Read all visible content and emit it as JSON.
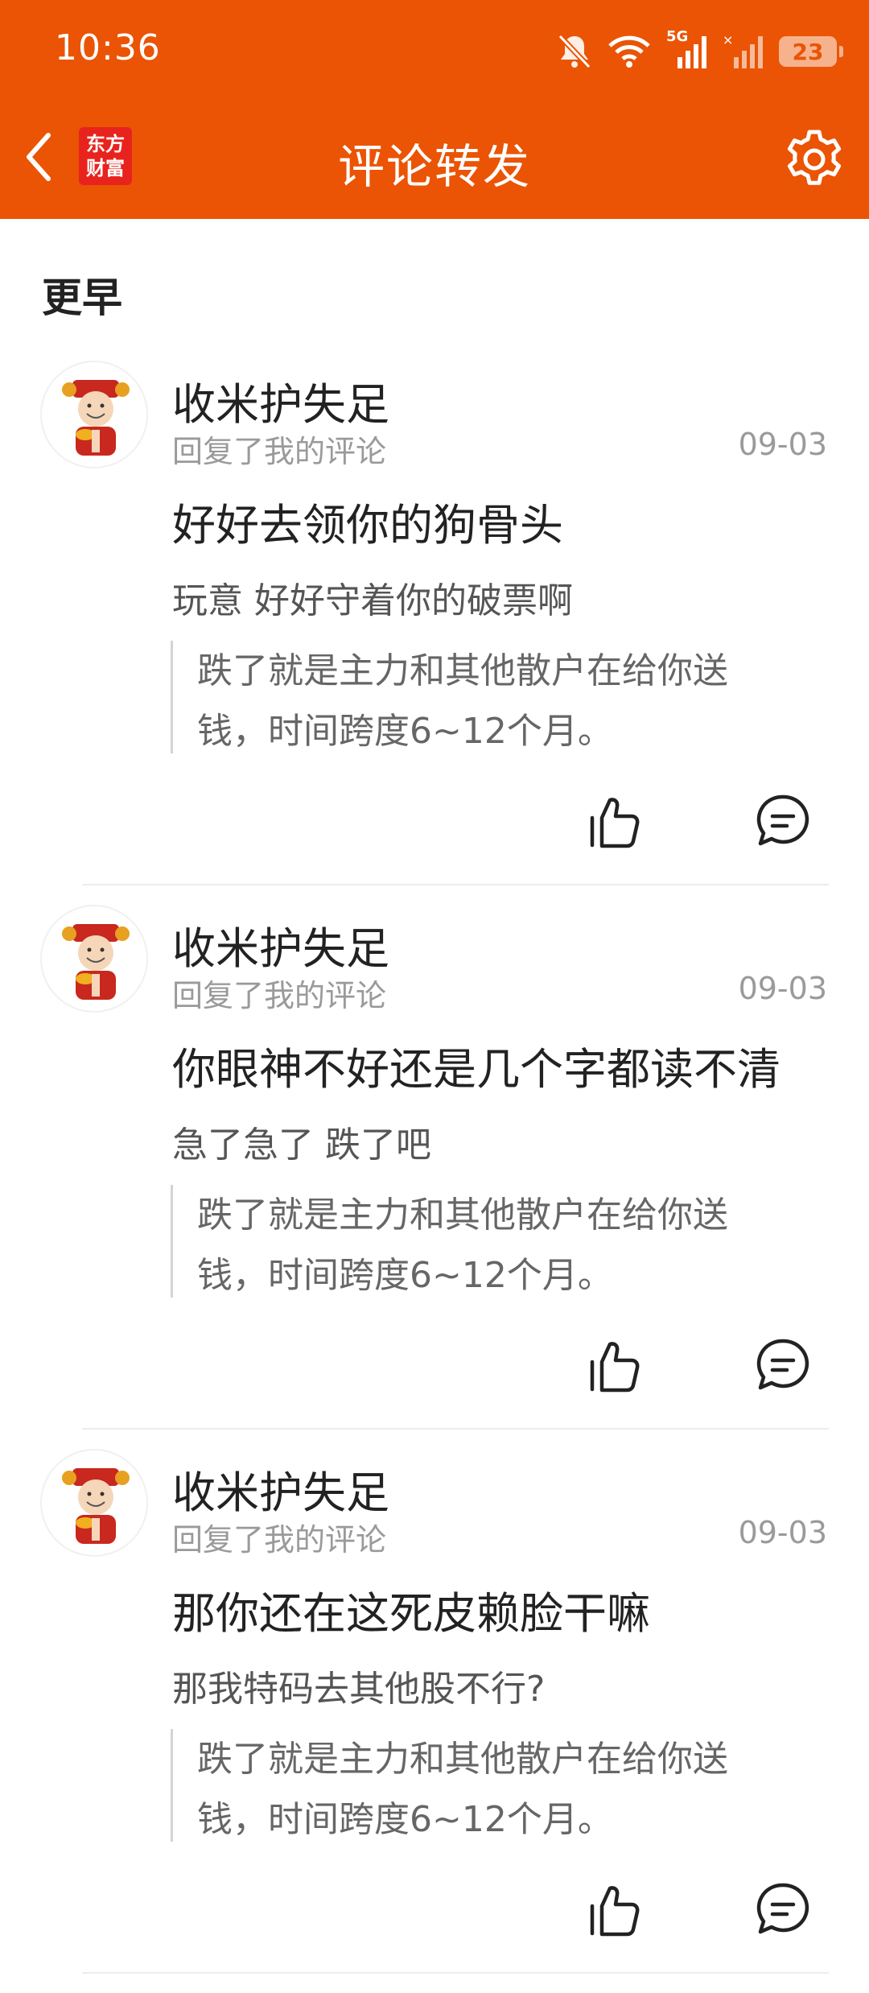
{
  "status_bar": {
    "time": "10:36",
    "network_label": "5G",
    "battery": "23",
    "icons": [
      "bell-off-icon",
      "wifi-icon",
      "signal-5g-icon",
      "signal-no-service-icon",
      "battery-icon"
    ]
  },
  "header": {
    "title": "评论转发",
    "logo_line1": "东方",
    "logo_line2": "财富",
    "back_icon": "chevron-left-icon",
    "settings_icon": "gear-icon",
    "background_color": "#ea5404"
  },
  "section": {
    "label": "更早"
  },
  "comments": [
    {
      "user": "收米护失足",
      "action": "回复了我的评论",
      "date": "09-03",
      "reply_title": "好好去领你的狗骨头",
      "reply_body": "玩意 好好守着你的破票啊",
      "quote_line1": "跌了就是主力和其他散户在给你送",
      "quote_line2": "钱，时间跨度6~12个月。"
    },
    {
      "user": "收米护失足",
      "action": "回复了我的评论",
      "date": "09-03",
      "reply_title": "你眼神不好还是几个字都读不清",
      "reply_body": "急了急了 跌了吧",
      "quote_line1": "跌了就是主力和其他散户在给你送",
      "quote_line2": "钱，时间跨度6~12个月。"
    },
    {
      "user": "收米护失足",
      "action": "回复了我的评论",
      "date": "09-03",
      "reply_title": "那你还在这死皮赖脸干嘛",
      "reply_body": "那我特码去其他股不行?",
      "quote_line1": "跌了就是主力和其他散户在给你送",
      "quote_line2": "钱，时间跨度6~12个月。"
    }
  ]
}
